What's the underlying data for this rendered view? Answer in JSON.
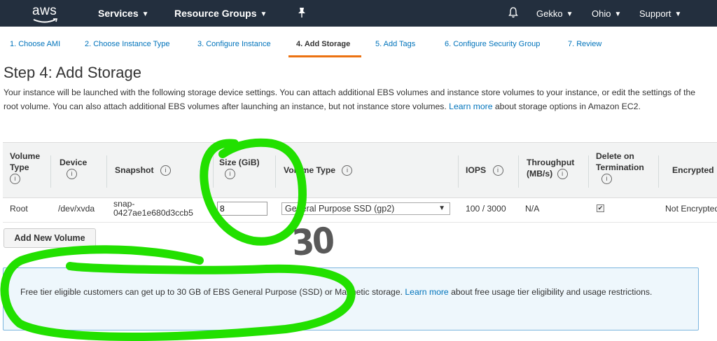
{
  "nav": {
    "logo": "aws",
    "services": "Services",
    "resource_groups": "Resource Groups",
    "account": "Gekko",
    "region": "Ohio",
    "support": "Support",
    "icons": [
      "pin-icon",
      "bell-icon"
    ]
  },
  "tabs": [
    {
      "label": "1. Choose AMI"
    },
    {
      "label": "2. Choose Instance Type"
    },
    {
      "label": "3. Configure Instance"
    },
    {
      "label": "4. Add Storage"
    },
    {
      "label": "5. Add Tags"
    },
    {
      "label": "6. Configure Security Group"
    },
    {
      "label": "7. Review"
    }
  ],
  "page": {
    "title": "Step 4: Add Storage",
    "desc_before": "Your instance will be launched with the following storage device settings. You can attach additional EBS volumes and instance store volumes to your instance, or edit the settings of the root volume. You can also attach additional EBS volumes after launching an instance, but not instance store volumes. ",
    "desc_link": "Learn more",
    "desc_after": " about storage options in Amazon EC2."
  },
  "table": {
    "headers": {
      "volume_type_1": "Volume",
      "volume_type_2": "Type",
      "device": "Device",
      "snapshot": "Snapshot",
      "size": "Size (GiB)",
      "volume_type": "Volume Type",
      "iops": "IOPS",
      "throughput_1": "Throughput",
      "throughput_2": "(MB/s)",
      "delete_1": "Delete on",
      "delete_2": "Termination",
      "encrypted": "Encrypted"
    },
    "info_glyph": "i",
    "row": {
      "volume_type": "Root",
      "device": "/dev/xvda",
      "snapshot_1": "snap-",
      "snapshot_2": "0427ae1e680d3ccb5",
      "size": "8",
      "volume_type_select": "General Purpose SSD (gp2)",
      "iops": "100 / 3000",
      "throughput": "N/A",
      "delete_on_termination": true,
      "check_glyph": "✔",
      "encrypted": "Not Encrypted"
    }
  },
  "add_button": "Add New Volume",
  "alert": {
    "before": "Free tier eligible customers can get up to 30 GB of EBS General Purpose (SSD) or Magnetic storage. ",
    "link": "Learn more",
    "after": " about free usage tier eligibility and usage restrictions."
  },
  "annotation": {
    "handwritten_text": "30",
    "marker_color": "#22e000"
  },
  "colors": {
    "nav_bg": "#232f3e",
    "active_tab_underline": "#ec7211",
    "link": "#0073bb",
    "alert_bg": "#eef7fc",
    "alert_border": "#7cb6df"
  }
}
